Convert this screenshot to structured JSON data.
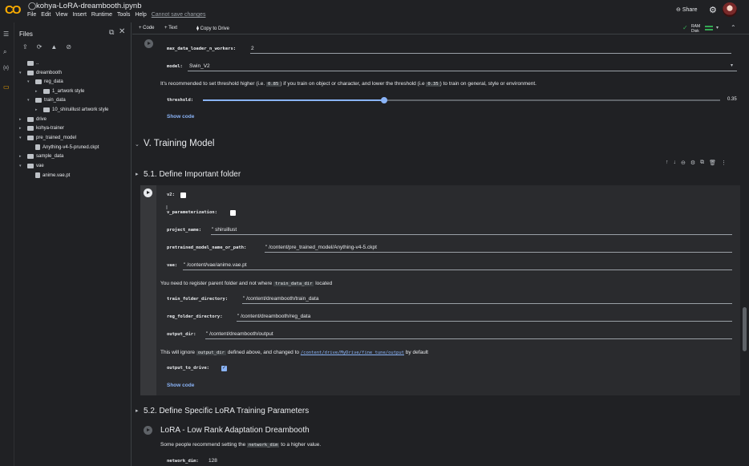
{
  "app": {
    "logo_text": "CO",
    "notebook_name": "kohya-LoRA-dreambooth.ipynb",
    "menu": [
      "File",
      "Edit",
      "View",
      "Insert",
      "Runtime",
      "Tools",
      "Help"
    ],
    "save_warning": "Cannot save changes",
    "share_label": "Share",
    "accent": "#f9ab00"
  },
  "toolbar": {
    "add_code": "+ Code",
    "add_text": "+ Text",
    "copy_to_drive": "Copy to Drive",
    "ram": "RAM",
    "disk": "Disk"
  },
  "sidebar": {
    "title": "Files",
    "tree": [
      {
        "label": "..",
        "kind": "folder",
        "depth": 0,
        "caret": ""
      },
      {
        "label": "dreambooth",
        "kind": "folder",
        "depth": 0,
        "caret": "▾"
      },
      {
        "label": "reg_data",
        "kind": "folder",
        "depth": 1,
        "caret": "▾"
      },
      {
        "label": "1_artwork style",
        "kind": "folder",
        "depth": 2,
        "caret": "▸"
      },
      {
        "label": "train_data",
        "kind": "folder",
        "depth": 1,
        "caret": "▾"
      },
      {
        "label": "10_shiruillust artwork style",
        "kind": "folder",
        "depth": 2,
        "caret": "▸"
      },
      {
        "label": "drive",
        "kind": "folder",
        "depth": 0,
        "caret": "▸"
      },
      {
        "label": "kohya-trainer",
        "kind": "folder",
        "depth": 0,
        "caret": "▸"
      },
      {
        "label": "pre_trained_model",
        "kind": "folder",
        "depth": 0,
        "caret": "▾"
      },
      {
        "label": "Anything-v4-5-pruned.ckpt",
        "kind": "file",
        "depth": 1,
        "caret": ""
      },
      {
        "label": "sample_data",
        "kind": "folder",
        "depth": 0,
        "caret": "▸"
      },
      {
        "label": "vae",
        "kind": "folder",
        "depth": 0,
        "caret": "▾"
      },
      {
        "label": "anime.vae.pt",
        "kind": "file",
        "depth": 1,
        "caret": ""
      }
    ]
  },
  "top_cell": {
    "workers_label": "max_data_loader_n_workers:",
    "workers_value": "2",
    "model_label": "model:",
    "model_value": "Swin_V2",
    "threshold_note_a": "It's recommended to set threshold higher (i.e.",
    "threshold_code_a": "0.85",
    "threshold_note_b": ") if you train on object or character, and lower the threshold (i.e",
    "threshold_code_b": "0.35",
    "threshold_note_c": ") to train on general, style or environment.",
    "threshold_label": "threshold:",
    "threshold_value": "0.35",
    "threshold_fraction": 0.35,
    "show_code": "Show code"
  },
  "section5": {
    "title": "V. Training Model",
    "sub1": "5.1. Define Important folder",
    "v2_label": "v2:",
    "vparam_label": "v_parameterization:",
    "project_label": "project_name:",
    "project_value": "shiruillust",
    "pretrained_label": "pretrained_model_name_or_path:",
    "pretrained_value": "/content/pre_trained_model/Anything-v4-5.ckpt",
    "vae_label": "vae:",
    "vae_value": "/content/vae/anime.vae.pt",
    "register_note_a": "You need to register parent folder and not where",
    "register_code": "train_data_dir",
    "register_note_b": "located",
    "train_dir_label": "train_folder_directory:",
    "train_dir_value": "/content/dreambooth/train_data",
    "reg_dir_label": "reg_folder_directory:",
    "reg_dir_value": "/content/dreambooth/reg_data",
    "output_label": "output_dir:",
    "output_value": "/content/dreambooth/output",
    "ignore_note_a": "This will ignore",
    "ignore_code": "output_dir",
    "ignore_note_b": "defined above, and changed to",
    "ignore_link": "/content/drive/MyDrive/fine_tune/output",
    "ignore_note_c": "by default",
    "output_drive_label": "output_to_drive:",
    "show_code": "Show code",
    "sub2": "5.2. Define Specific LoRA Training Parameters",
    "lora_title": "LoRA - Low Rank Adaptation Dreambooth",
    "lora_note_a": "Some people recommend setting the",
    "lora_code": "network_dim",
    "lora_note_b": "to a higher value.",
    "network_dim_label": "network_dim:",
    "network_dim_value": "128"
  }
}
